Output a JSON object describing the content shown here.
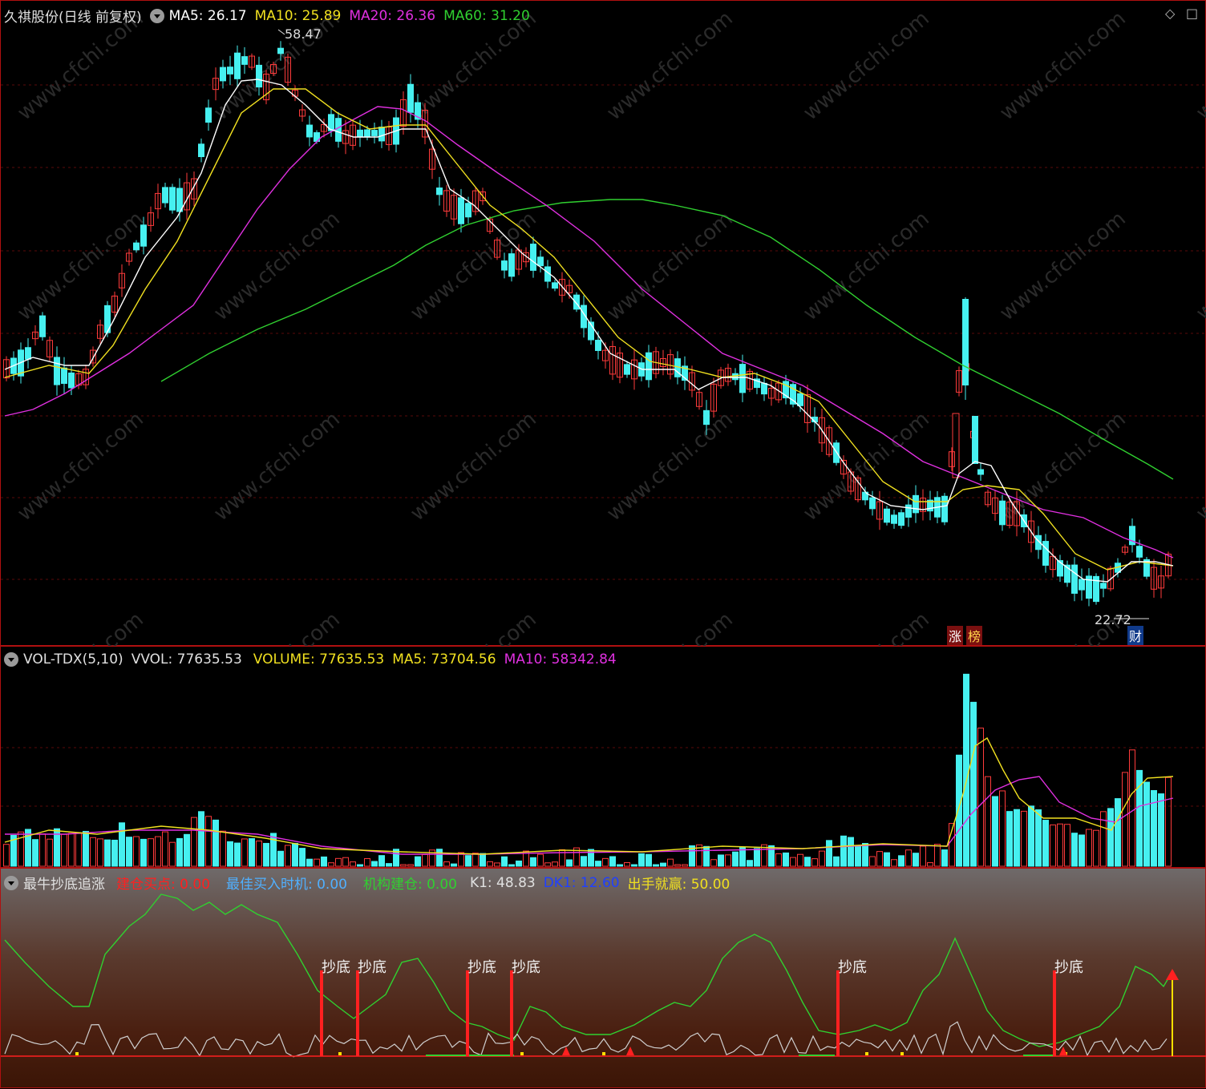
{
  "colors": {
    "up": "#ff3b3b",
    "down": "#46f0f0",
    "ma5": "#ffffff",
    "ma10": "#f0e020",
    "ma20": "#e030e0",
    "ma60": "#30d030",
    "k1": "#cfcfcf",
    "osc": "#30d030"
  },
  "price_panel": {
    "stock_name": "久祺股份",
    "period_label": "(日线 前复权)",
    "ma5_label": "MA5: 26.17",
    "ma10_label": "MA10: 25.89",
    "ma20_label": "MA20: 26.36",
    "ma60_label": "MA60: 31.20",
    "high_label": "58.47",
    "low_label": "22.72",
    "tag_zhang": "涨",
    "tag_bang": "榜",
    "tag_cai": "财",
    "corner_icons": [
      "diamond-icon",
      "square-icon"
    ]
  },
  "volume_panel": {
    "indicator_name": "VOL-TDX(5,10)",
    "vvol_label": "VVOL: 77635.53",
    "volume_label": "VOLUME: 77635.53",
    "ma5_label": "MA5: 73704.56",
    "ma10_label": "MA10: 58342.84"
  },
  "indicator_panel": {
    "indicator_name": "最牛抄底追涨",
    "build_buy_label": "建仓买点: 0.00",
    "best_time_label": "最佳买入时机: 0.00",
    "inst_build_label": "机构建仓: 0.00",
    "k1_label": "K1: 48.83",
    "dk1_label": "DK1: 12.60",
    "win_label": "出手就赢: 50.00",
    "signal_text": "抄底"
  },
  "watermark": "www.cfchi.com"
}
